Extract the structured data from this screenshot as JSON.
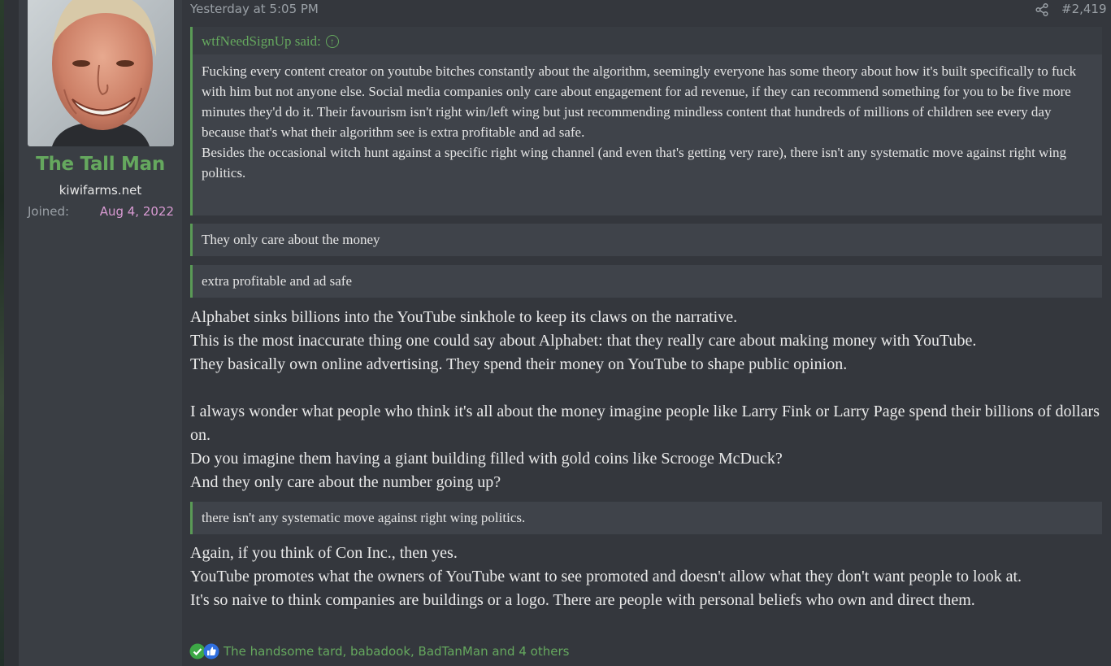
{
  "author": {
    "username": "The Tall Man",
    "title": "kiwifarms.net",
    "joined_label": "Joined:",
    "joined_date": "Aug 4, 2022"
  },
  "post": {
    "date": "Yesterday at 5:05 PM",
    "number": "#2,419",
    "share_icon": "share-icon"
  },
  "quotes": [
    {
      "author": "wtfNeedSignUp said:",
      "paragraphs": [
        "Fucking every content creator on youtube bitches constantly about the algorithm, seemingly everyone has some theory about how it's built specifically to fuck with him but not anyone else. Social media companies only care about engagement for ad revenue, if they can recommend something for you to be five more minutes they'd do it. Their favourism isn't right win/left wing but just recommending mindless content that hundreds of millions of children see every day because that's what their algorithm see is extra profitable and ad safe.",
        "Besides the occasional witch hunt against a specific right wing channel (and even that's getting very rare), there isn't any systematic move against right wing politics."
      ]
    },
    {
      "text": "They only care about the money"
    },
    {
      "text": "extra profitable and ad safe"
    },
    {
      "text": "there isn't any systematic move against right wing politics."
    }
  ],
  "body": {
    "block1": [
      "Alphabet sinks billions into the YouTube sinkhole to keep its claws on the narrative.",
      "This is the most inaccurate thing one could say about Alphabet: that they really care about making money with YouTube.",
      "They basically own online advertising. They spend their money on YouTube to shape public opinion."
    ],
    "block2": [
      "I always wonder what people who think it's all about the money imagine people like Larry Fink or Larry Page spend their billions of dollars on.",
      "Do you imagine them having a giant building filled with gold coins like Scrooge McDuck?",
      "And they only care about the number going up?"
    ],
    "block3": [
      "Again, if you think of Con Inc., then yes.",
      "YouTube promotes what the owners of YouTube want to see promoted and doesn't allow what they don't want people to look at.",
      "It's so naive to think companies are buildings or a logo. There are people with personal beliefs who own and direct them."
    ]
  },
  "reactions": {
    "icons": [
      "check-icon",
      "thumbs-up-icon"
    ],
    "users": "The handsome tard, babadook, BadTanMan and 4 others"
  },
  "colors": {
    "accent_green": "#65a85e",
    "joined_pink": "#d89ad2",
    "background": "#34373d"
  }
}
